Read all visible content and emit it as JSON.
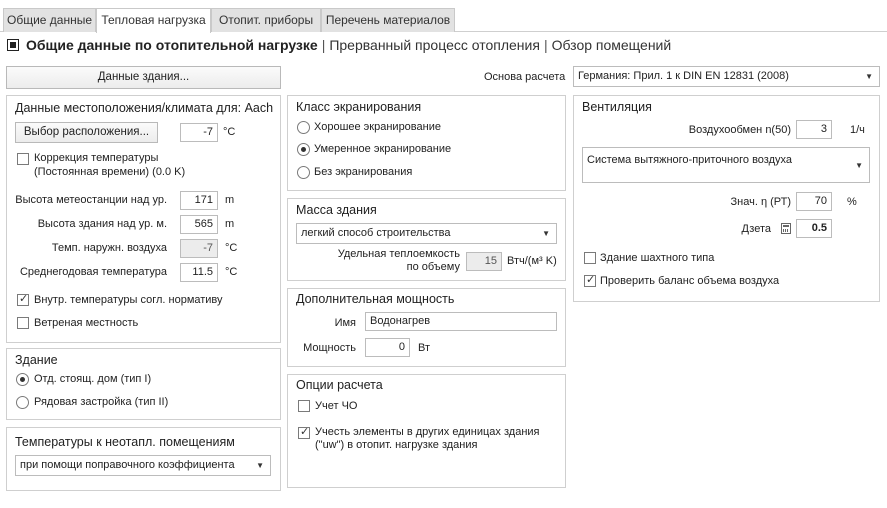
{
  "tabs": [
    "Общие данные",
    "Тепловая нагрузка",
    "Отопит. приборы",
    "Перечень материалов"
  ],
  "heading": {
    "title": "Общие данные по отопительной нагрузке",
    "link1": "Прерванный процесс отопления",
    "link2": "Обзор помещений",
    "sep": "|"
  },
  "building_data_button": "Данные здания...",
  "basis": {
    "label": "Основа расчета",
    "value": "Германия: Прил. 1 к DIN EN 12831 (2008)"
  },
  "location": {
    "title": "Данные местоположения/климата для: Aach",
    "choose_button": "Выбор расположения...",
    "temp_value": "-7",
    "temp_unit": "°C",
    "correction_label1": "Коррекция температуры",
    "correction_label2": "(Постоянная времени) (0.0 K)",
    "station_height_label": "Высота метеостанции над ур.",
    "station_height_value": "171",
    "station_height_unit": "m",
    "building_height_label": "Высота здания над ур. м.",
    "building_height_value": "565",
    "building_height_unit": "m",
    "outdoor_temp_label": "Темп. наружн. воздуха",
    "outdoor_temp_value": "-7",
    "outdoor_temp_unit": "°C",
    "annual_temp_label": "Среднегодовая температура",
    "annual_temp_value": "11.5",
    "annual_temp_unit": "°C",
    "internal_temp_label": "Внутр. температуры согл. нормативу",
    "windy_label": "Ветреная местность",
    "correction_checked": false,
    "internal_temp_checked": true,
    "windy_checked": false
  },
  "building": {
    "title": "Здание",
    "option1": "Отд. стоящ. дом (тип I)",
    "option2": "Рядовая застройка (тип II)"
  },
  "unheated": {
    "title": "Температуры к неотапл. помещениям",
    "value": "при помощи поправочного коэффициента"
  },
  "shielding": {
    "title": "Класс экранирования",
    "option1": "Хорошее экранирование",
    "option2": "Умеренное экранирование",
    "option3": "Без экранирования"
  },
  "mass": {
    "title": "Масса здания",
    "value": "легкий способ строительства",
    "capacity_label1": "Удельная теплоемкость",
    "capacity_label2": "по объему",
    "capacity_value": "15",
    "capacity_unit": "Втч/(м³ K)"
  },
  "extra_power": {
    "title": "Дополнительная мощность",
    "name_label": "Имя",
    "name_value": "Водонагрев",
    "power_label": "Мощность",
    "power_value": "0",
    "power_unit": "Вт"
  },
  "options": {
    "title": "Опции расчета",
    "option1": "Учет ЧО",
    "option2_line1": "Учесть элементы в других единицах здания",
    "option2_line2": "(\"uw\") в отопит. нагрузке здания",
    "option1_checked": false,
    "option2_checked": true
  },
  "ventilation": {
    "title": "Вентиляция",
    "exchange_label": "Воздухообмен n(50)",
    "exchange_value": "3",
    "exchange_unit": "1/ч",
    "system_value": "Система вытяжного-приточного воздуха",
    "eta_label": "Знач. η (РТ)",
    "eta_value": "70",
    "eta_unit": "%",
    "zeta_label": "Дзета",
    "zeta_value": "0.5",
    "shaft_label": "Здание шахтного типа",
    "balance_label": "Проверить баланс объема воздуха",
    "shaft_checked": false,
    "balance_checked": true
  }
}
